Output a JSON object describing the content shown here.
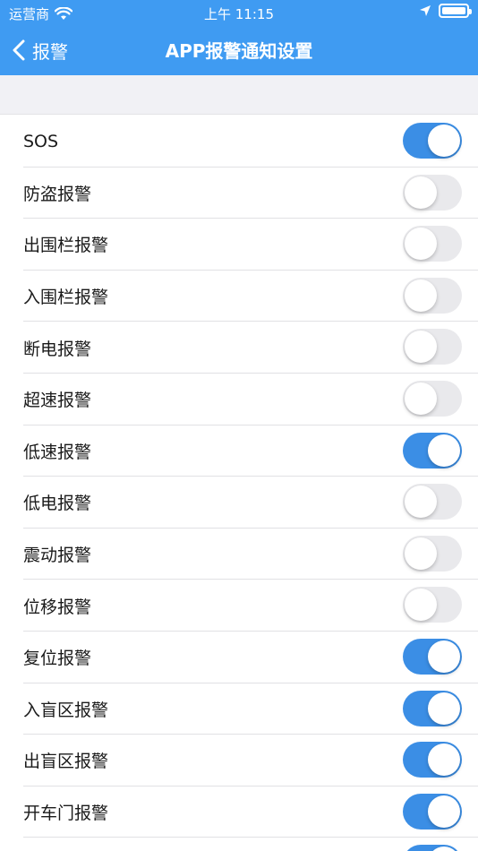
{
  "status_bar": {
    "carrier": "运营商",
    "time": "上午 11:15"
  },
  "nav": {
    "back_label": "报警",
    "title": "APP报警通知设置"
  },
  "colors": {
    "header": "#3f9bf2",
    "toggle_on": "#3b8ee5",
    "toggle_off": "#e9e9ec"
  },
  "alarms": [
    {
      "label": "SOS",
      "on": true
    },
    {
      "label": "防盗报警",
      "on": false
    },
    {
      "label": "出围栏报警",
      "on": false
    },
    {
      "label": "入围栏报警",
      "on": false
    },
    {
      "label": "断电报警",
      "on": false
    },
    {
      "label": "超速报警",
      "on": false
    },
    {
      "label": "低速报警",
      "on": true
    },
    {
      "label": "低电报警",
      "on": false
    },
    {
      "label": "震动报警",
      "on": false
    },
    {
      "label": "位移报警",
      "on": false
    },
    {
      "label": "复位报警",
      "on": true
    },
    {
      "label": "入盲区报警",
      "on": true
    },
    {
      "label": "出盲区报警",
      "on": true
    },
    {
      "label": "开车门报警",
      "on": true
    },
    {
      "label": "",
      "on": true
    }
  ]
}
